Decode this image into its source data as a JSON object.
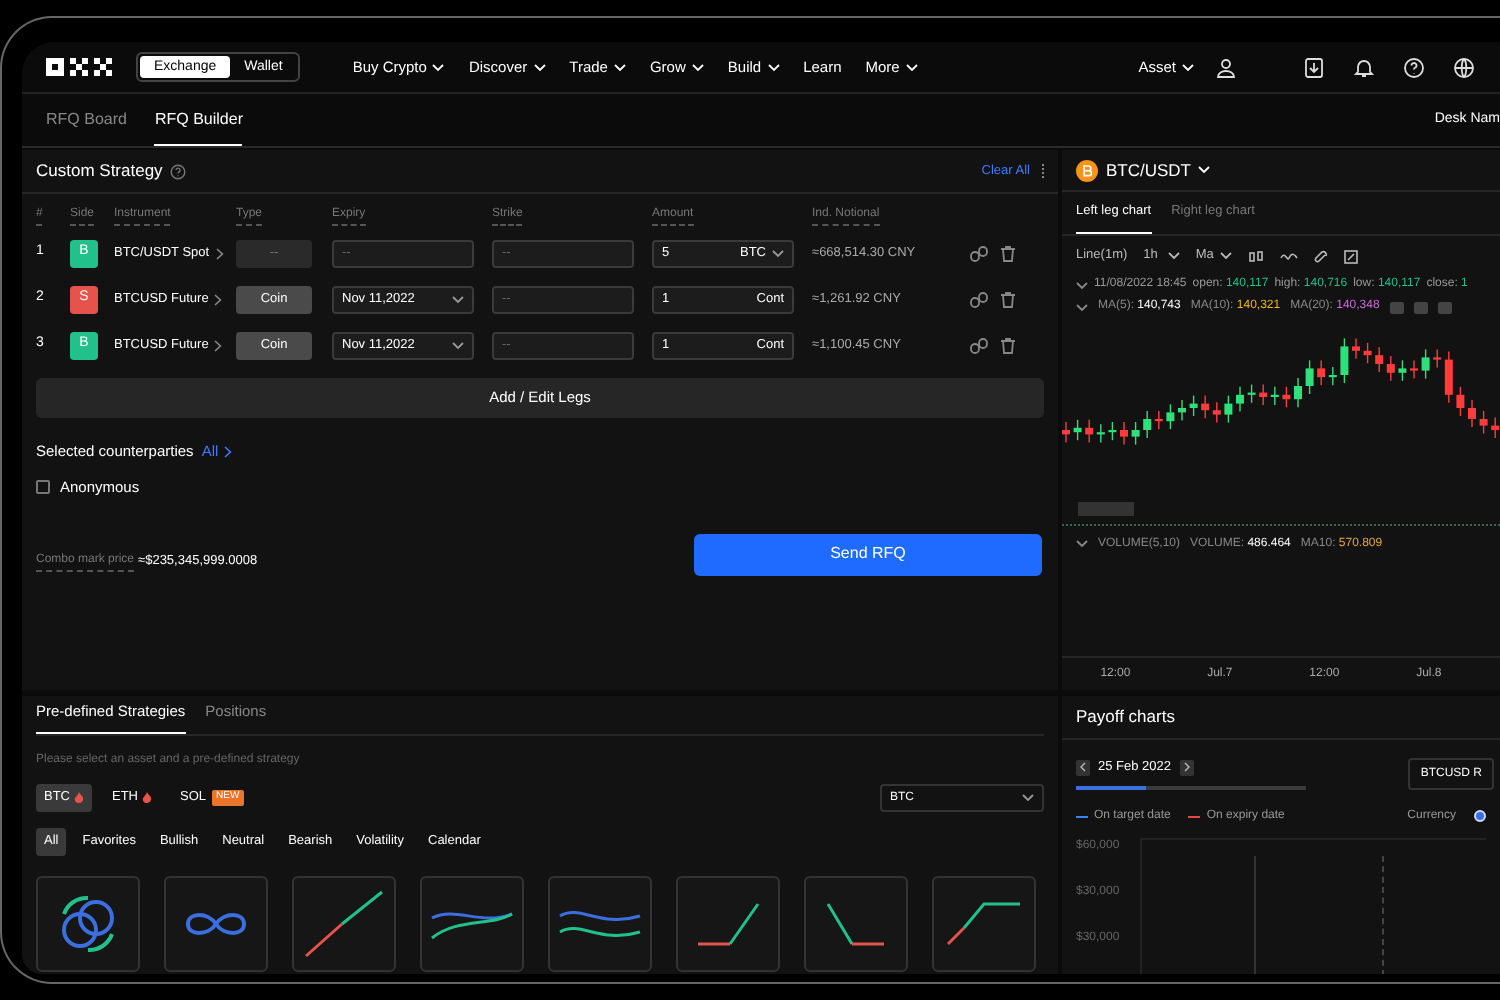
{
  "nav": {
    "toggle": [
      {
        "label": "Exchange",
        "selected": true
      },
      {
        "label": "Wallet",
        "selected": false
      }
    ],
    "menu": [
      {
        "label": "Buy Crypto",
        "dropdown": true
      },
      {
        "label": "Discover",
        "dropdown": true
      },
      {
        "label": "Trade",
        "dropdown": true
      },
      {
        "label": "Grow",
        "dropdown": true
      },
      {
        "label": "Build",
        "dropdown": true
      },
      {
        "label": "Learn",
        "dropdown": false
      },
      {
        "label": "More",
        "dropdown": true
      }
    ],
    "asset": "Asset"
  },
  "subtabs": [
    {
      "label": "RFQ Board",
      "selected": false
    },
    {
      "label": "RFQ Builder",
      "selected": true
    }
  ],
  "desk": "Desk Nam",
  "custom_strategy": {
    "title": "Custom Strategy",
    "clear": "Clear All",
    "columns": [
      "#",
      "Side",
      "Instrument",
      "Type",
      "Expiry",
      "Strike",
      "Amount",
      "Ind. Notional"
    ],
    "legs": [
      {
        "index": "1",
        "side": "B",
        "color": "#22c08a",
        "instrument": "BTC/USDT Spot",
        "type": {
          "value": "--",
          "enabled": false
        },
        "expiry": {
          "placeholder": "--",
          "dropdown": false
        },
        "strike": {
          "placeholder": "--"
        },
        "amount": {
          "value": "5",
          "unit": "BTC",
          "dropdown": true
        },
        "notional": "≈668,514.30 CNY"
      },
      {
        "index": "2",
        "side": "S",
        "color": "#e5534b",
        "instrument": "BTCUSD Future",
        "type": {
          "value": "Coin",
          "enabled": true
        },
        "expiry": {
          "value": "Nov 11,2022",
          "dropdown": true
        },
        "strike": {
          "placeholder": "--"
        },
        "amount": {
          "value": "1",
          "unit": "Cont",
          "dropdown": false
        },
        "notional": "≈1,261.92 CNY"
      },
      {
        "index": "3",
        "side": "B",
        "color": "#22c08a",
        "instrument": "BTCUSD Future",
        "type": {
          "value": "Coin",
          "enabled": true
        },
        "expiry": {
          "value": "Nov 11,2022",
          "dropdown": true
        },
        "strike": {
          "placeholder": "--"
        },
        "amount": {
          "value": "1",
          "unit": "Cont",
          "dropdown": false
        },
        "notional": "≈1,100.45 CNY"
      }
    ],
    "add_button": "Add / Edit Legs",
    "counterparties": {
      "label": "Selected counterparties",
      "link": "All"
    },
    "anonymous": {
      "label": "Anonymous",
      "checked": false
    },
    "combo": {
      "label": "Combo mark price",
      "value": "≈$235,345,999.0008"
    },
    "send": "Send RFQ"
  },
  "strategies": {
    "tabs": [
      {
        "label": "Pre-defined Strategies",
        "selected": true
      },
      {
        "label": "Positions",
        "selected": false
      }
    ],
    "hint": "Please select an asset and a pre-defined strategy",
    "assets": [
      {
        "label": "BTC",
        "selected": true,
        "kind": "hot"
      },
      {
        "label": "ETH",
        "selected": false,
        "kind": "hot"
      },
      {
        "label": "SOL",
        "selected": false,
        "kind": "new",
        "badge": "NEW"
      }
    ],
    "select": "BTC",
    "filters": [
      {
        "label": "All",
        "selected": true
      },
      {
        "label": "Favorites",
        "selected": false
      },
      {
        "label": "Bullish",
        "selected": false
      },
      {
        "label": "Neutral",
        "selected": false
      },
      {
        "label": "Bearish",
        "selected": false
      },
      {
        "label": "Volatility",
        "selected": false
      },
      {
        "label": "Calendar",
        "selected": false
      }
    ],
    "cards": [
      {
        "kind": "swap"
      },
      {
        "kind": "infinity"
      },
      {
        "kind": "diagonal"
      },
      {
        "kind": "waves-cross"
      },
      {
        "kind": "waves"
      },
      {
        "kind": "long-call"
      },
      {
        "kind": "long-put"
      },
      {
        "kind": "bull-spread"
      }
    ]
  },
  "chart": {
    "pair": "BTC/USDT",
    "tabs": [
      {
        "label": "Left leg chart",
        "selected": true
      },
      {
        "label": "Right leg chart",
        "selected": false
      }
    ],
    "toolbar": {
      "type": "Line(1m)",
      "interval": "1h",
      "indicator": "Ma"
    },
    "ohlc": {
      "date": "11/08/2022 18:45",
      "fields": [
        {
          "label": "open:",
          "value": "140,117"
        },
        {
          "label": "high:",
          "value": "140,716"
        },
        {
          "label": "low:",
          "value": "140,117"
        },
        {
          "label": "close:",
          "value": "1"
        }
      ]
    },
    "ma": [
      {
        "label": "MA(5):",
        "value": "140,743",
        "color": "#ffffff"
      },
      {
        "label": "MA(10):",
        "value": "140,321",
        "color": "#f0b90b"
      },
      {
        "label": "MA(20):",
        "value": "140,348",
        "color": "#c86dd7"
      }
    ],
    "volume": {
      "label": "VOLUME(5,10)",
      "fields": [
        {
          "label": "VOLUME:",
          "value": "486.464",
          "color": "#ffffff"
        },
        {
          "label": "MA10:",
          "value": "570.809",
          "color": "#e8a93a"
        }
      ]
    },
    "time_axis": [
      "12:00",
      "Jul.7",
      "12:00",
      "Jul.8"
    ]
  },
  "payoff": {
    "title": "Payoff charts",
    "date": "25 Feb 2022",
    "level": 0.3,
    "select": "BTCUSD R",
    "legend": [
      {
        "label": "On target date",
        "color": "#3b82f6"
      },
      {
        "label": "On expiry date",
        "color": "#ef4444"
      }
    ],
    "currency": {
      "label": "Currency",
      "selected": true
    },
    "yaxis": [
      "$60,000",
      "$30,000",
      "$30,000"
    ]
  }
}
